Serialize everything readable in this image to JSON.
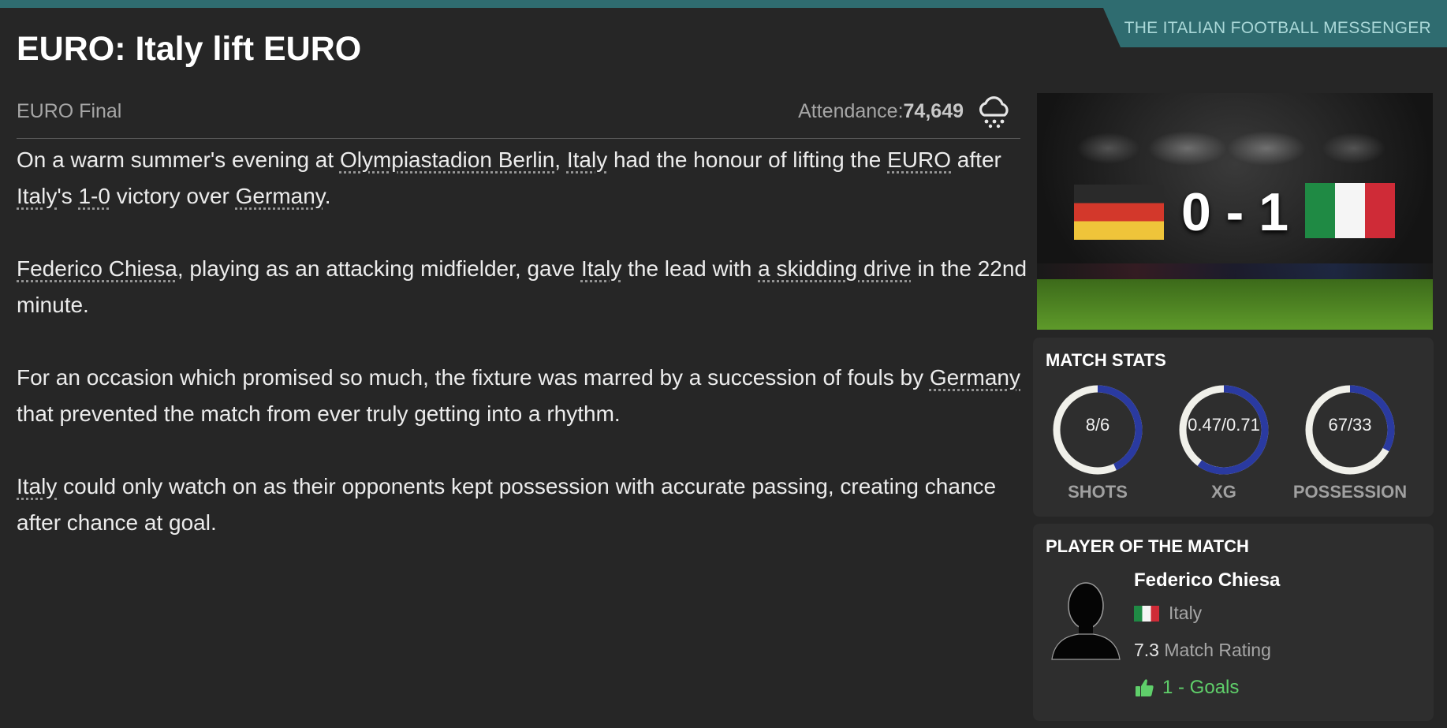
{
  "publisher": "THE ITALIAN FOOTBALL MESSENGER",
  "headline": "EURO: Italy lift EURO",
  "meta": {
    "competition": "EURO Final",
    "attendance_label": "Attendance:",
    "attendance_value": "74,649",
    "weather_icon": "rain-cloud-icon"
  },
  "article": {
    "p1": {
      "t1": "On a warm summer's evening at ",
      "venue": "Olympiastadion Berlin",
      "t2": ", ",
      "team1": "Italy",
      "t3": " had the honour of lifting the ",
      "trophy": "EURO",
      "t4": " after ",
      "team2": "Italy",
      "t5": "'s ",
      "result": "1-0",
      "t6": " victory over ",
      "opponent": "Germany",
      "t7": "."
    },
    "p2": {
      "player": "Federico Chiesa",
      "t1": ", playing as an attacking midfielder, gave ",
      "team": "Italy",
      "t2": " the lead with ",
      "goal_type": "a skidding drive",
      "t3": " in the 22nd minute."
    },
    "p3": {
      "t1": "For an occasion which promised so much, the fixture was marred by a succession of fouls by ",
      "team": "Germany",
      "t2": " that prevented the match from ever truly getting into a rhythm."
    },
    "p4": {
      "team": "Italy",
      "t1": " could only watch on as their opponents kept possession with accurate passing, creating chance after chance at goal."
    }
  },
  "scoreboard": {
    "home_flag": "germany-flag",
    "away_flag": "italy-flag",
    "score": "0 - 1"
  },
  "match_stats": {
    "title": "MATCH STATS",
    "ring_color": "#2a3aa0",
    "track_color": "#f0f0ea",
    "items": [
      {
        "label": "SHOTS",
        "value": "8/6",
        "share": 0.43
      },
      {
        "label": "XG",
        "value": "0.47/0.71",
        "share": 0.6
      },
      {
        "label": "POSSESSION",
        "value": "67/33",
        "share": 0.33
      }
    ]
  },
  "potm": {
    "title": "PLAYER OF THE MATCH",
    "name": "Federico Chiesa",
    "country": "Italy",
    "rating_value": "7.3",
    "rating_label": "Match Rating",
    "goals": "1 - Goals",
    "goals_icon": "thumbs-up-icon",
    "accent_color": "#5fcf6a"
  }
}
